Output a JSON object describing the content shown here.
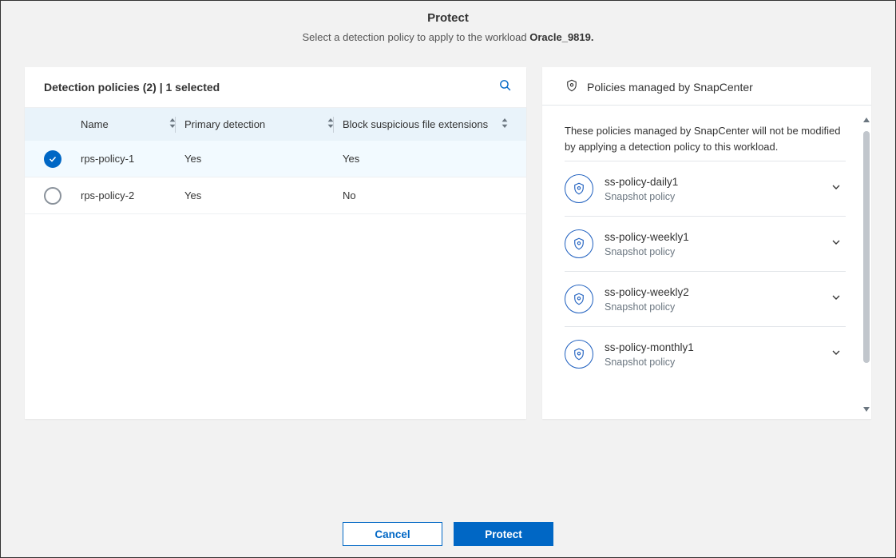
{
  "header": {
    "title": "Protect",
    "subtitle_prefix": "Select a detection policy to apply to the workload ",
    "workload_name": "Oracle_9819."
  },
  "detection_panel": {
    "title": "Detection policies (2) | 1 selected",
    "columns": {
      "name": "Name",
      "primary": "Primary detection",
      "block": "Block suspicious file extensions"
    },
    "rows": [
      {
        "selected": true,
        "name": "rps-policy-1",
        "primary": "Yes",
        "block": "Yes"
      },
      {
        "selected": false,
        "name": "rps-policy-2",
        "primary": "Yes",
        "block": "No"
      }
    ]
  },
  "managed_panel": {
    "title": "Policies managed by SnapCenter",
    "info": "These policies managed by SnapCenter will not be modified by applying a detection policy to this workload.",
    "type_label": "Snapshot policy",
    "items": [
      {
        "name": "ss-policy-daily1"
      },
      {
        "name": "ss-policy-weekly1"
      },
      {
        "name": "ss-policy-weekly2"
      },
      {
        "name": "ss-policy-monthly1"
      }
    ]
  },
  "footer": {
    "cancel": "Cancel",
    "protect": "Protect"
  }
}
